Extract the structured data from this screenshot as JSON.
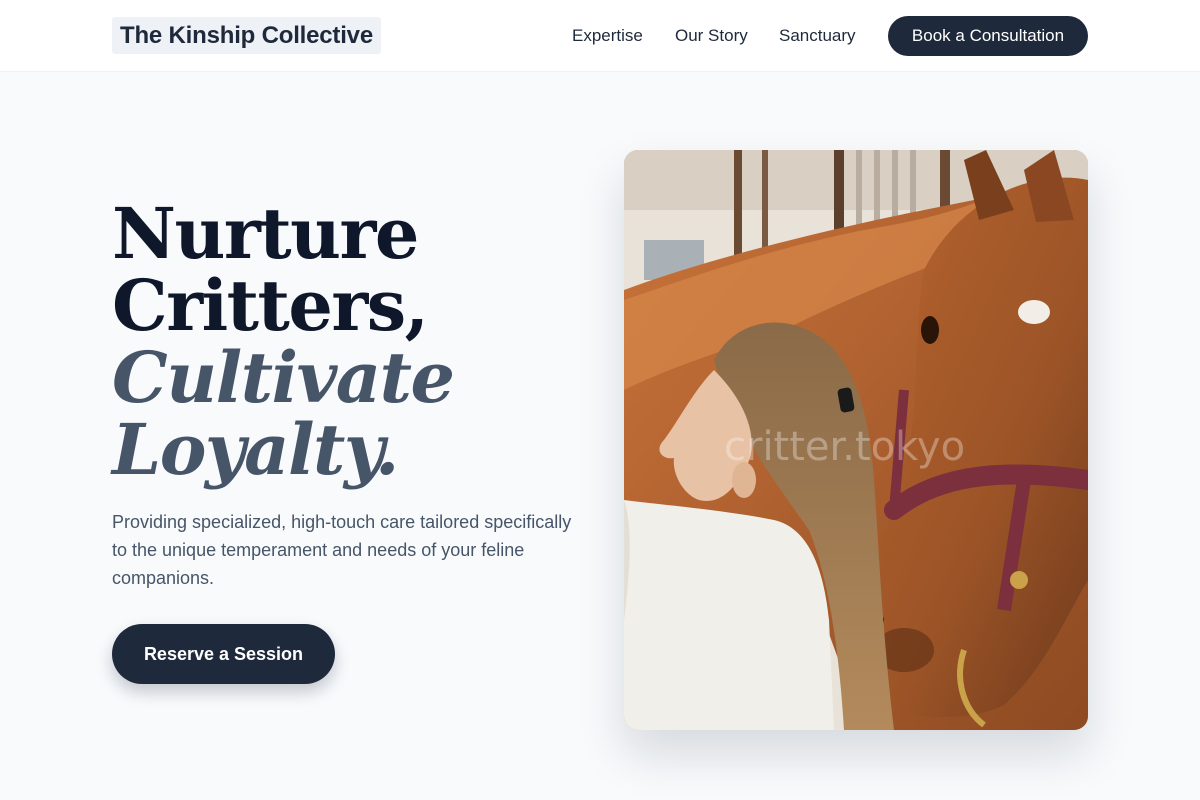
{
  "header": {
    "brand": "The Kinship Collective",
    "nav": [
      "Expertise",
      "Our Story",
      "Sanctuary"
    ],
    "cta_label": "Book a Consultation"
  },
  "hero": {
    "headline": [
      "Nurture",
      "Critters,",
      "Cultivate",
      "Loyalty."
    ],
    "description": "Providing specialized, high-touch care tailored specifically to the unique temperament and needs of your feline companions.",
    "cta_label": "Reserve a Session",
    "image_watermark": "critter.tokyo"
  },
  "colors": {
    "primary": "#1e293b",
    "headline": "#0f172a",
    "accent_text": "#475569",
    "background": "#f8fafc"
  }
}
